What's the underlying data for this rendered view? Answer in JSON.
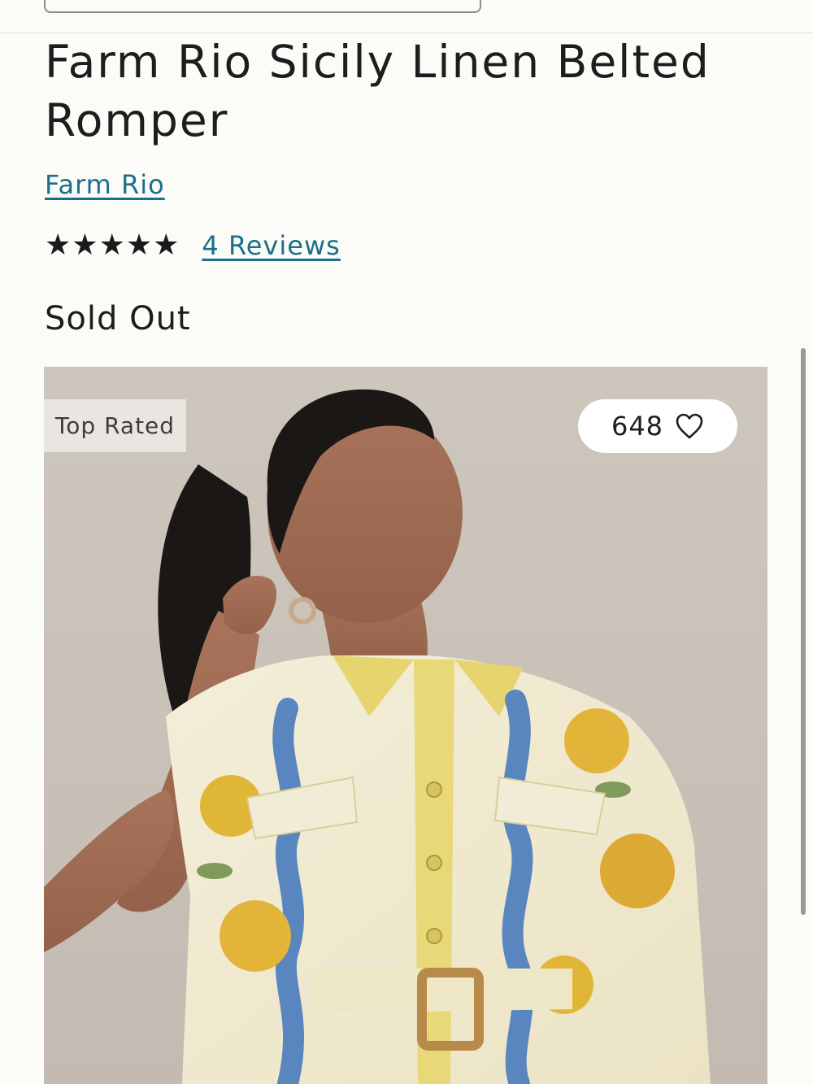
{
  "product": {
    "title": "Farm Rio Sicily Linen Belted Romper",
    "brand": "Farm Rio",
    "rating": 5,
    "rating_max": 5,
    "reviews_label": "4 Reviews",
    "availability": "Sold Out"
  },
  "image": {
    "badge": "Top Rated",
    "favorites_count": "648",
    "favorite_icon": "heart-outline-icon"
  },
  "colors": {
    "link": "#1b6f8a",
    "background": "#fbfbf7"
  }
}
